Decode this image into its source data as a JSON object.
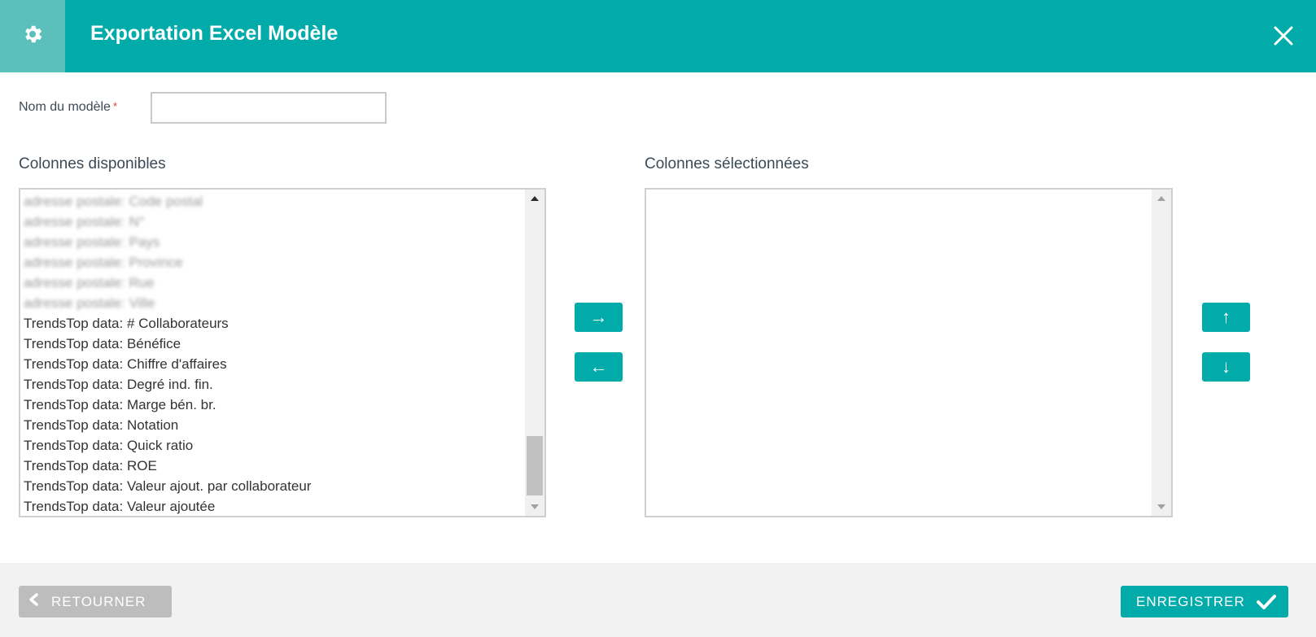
{
  "dialog": {
    "title": "Exportation Excel Modèle",
    "icon": "gear-icon",
    "close_icon": "close-icon",
    "accent_color": "#00aba9"
  },
  "form": {
    "name_label": "Nom du modèle",
    "required_marker": "*",
    "name_value": ""
  },
  "available": {
    "title": "Colonnes disponibles",
    "items": [
      {
        "label": "adresse postale: Code postal",
        "blurred": true
      },
      {
        "label": "adresse postale: N°",
        "blurred": true
      },
      {
        "label": "adresse postale: Pays",
        "blurred": true
      },
      {
        "label": "adresse postale: Province",
        "blurred": true
      },
      {
        "label": "adresse postale: Rue",
        "blurred": true
      },
      {
        "label": "adresse postale: Ville",
        "blurred": true
      },
      {
        "label": "TrendsTop data: # Collaborateurs",
        "blurred": false
      },
      {
        "label": "TrendsTop data: Bénéfice",
        "blurred": false
      },
      {
        "label": "TrendsTop data: Chiffre d'affaires",
        "blurred": false
      },
      {
        "label": "TrendsTop data: Degré ind. fin.",
        "blurred": false
      },
      {
        "label": "TrendsTop data: Marge bén. br.",
        "blurred": false
      },
      {
        "label": "TrendsTop data: Notation",
        "blurred": false
      },
      {
        "label": "TrendsTop data: Quick ratio",
        "blurred": false
      },
      {
        "label": "TrendsTop data: ROE",
        "blurred": false
      },
      {
        "label": "TrendsTop data: Valeur ajout. par collaborateur",
        "blurred": false
      },
      {
        "label": "TrendsTop data: Valeur ajoutée",
        "blurred": false
      }
    ]
  },
  "selected": {
    "title": "Colonnes sélectionnées",
    "items": []
  },
  "transfer": {
    "add_label": "→",
    "remove_label": "←",
    "move_up_label": "↑",
    "move_down_label": "↓"
  },
  "footer": {
    "back_label": "RETOURNER",
    "save_label": "ENREGISTRER"
  }
}
